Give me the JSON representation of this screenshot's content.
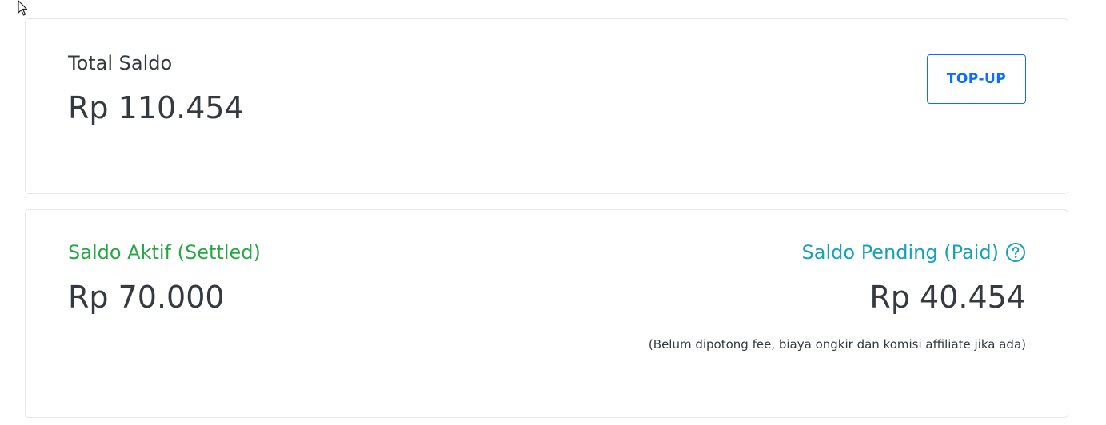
{
  "total": {
    "label": "Total Saldo",
    "amount": "Rp 110.454",
    "topup_label": "TOP-UP"
  },
  "detail": {
    "active": {
      "label": "Saldo Aktif (Settled)",
      "amount": "Rp 70.000"
    },
    "pending": {
      "label": "Saldo Pending (Paid)",
      "amount": "Rp 40.454",
      "note": "(Belum dipotong fee, biaya ongkir dan komisi affiliate jika ada)",
      "help_icon": "question-circle-icon"
    }
  },
  "colors": {
    "accent_blue": "#0d6efd",
    "active_green": "#28a745",
    "pending_teal": "#17a2b8",
    "text_dark": "#343a40"
  }
}
